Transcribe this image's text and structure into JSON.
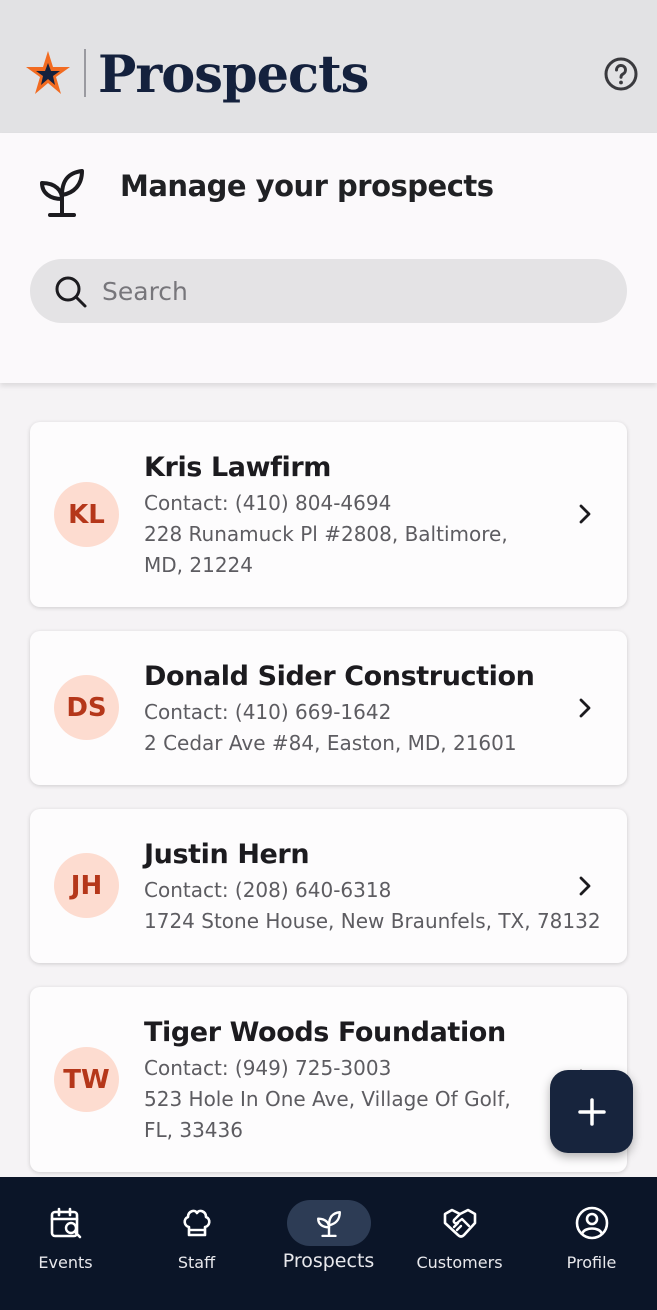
{
  "header": {
    "title": "Prospects",
    "help_icon": "help-circle-icon",
    "logo": "star-logo",
    "colors": {
      "background": "#e2e2e4",
      "title": "#14213d",
      "star_orange": "#f26b21",
      "star_navy": "#14213d"
    }
  },
  "panel": {
    "icon": "sprout-icon",
    "title": "Manage your prospects",
    "search_placeholder": "Search",
    "search_value": ""
  },
  "prospects": [
    {
      "initials": "KL",
      "name": "Kris Lawfirm",
      "contact": "Contact: (410) 804-4694",
      "address": "228 Runamuck Pl #2808, Baltimore, MD, 21224"
    },
    {
      "initials": "DS",
      "name": "Donald Sider Construction",
      "contact": "Contact: (410) 669-1642",
      "address": "2 Cedar Ave #84, Easton, MD, 21601"
    },
    {
      "initials": "JH",
      "name": "Justin Hern",
      "contact": "Contact: (208) 640-6318",
      "address": "1724 Stone House, New Braunfels, TX, 78132"
    },
    {
      "initials": "TW",
      "name": "Tiger Woods Foundation",
      "contact": "Contact: (949) 725-3003",
      "address": "523 Hole In One Ave, Village Of Golf, FL, 33436"
    }
  ],
  "fab": {
    "icon": "plus-icon"
  },
  "nav": {
    "items": [
      {
        "label": "Events",
        "icon": "calendar-search-icon"
      },
      {
        "label": "Staff",
        "icon": "chef-hat-icon"
      },
      {
        "label": "Prospects",
        "icon": "sprout-icon",
        "active": true
      },
      {
        "label": "Customers",
        "icon": "handshake-icon"
      },
      {
        "label": "Profile",
        "icon": "user-circle-icon"
      }
    ],
    "colors": {
      "background": "#0b1528",
      "active_pill": "#2d3c55"
    }
  },
  "colors": {
    "avatar_bg": "#fddcd0",
    "avatar_text": "#b5371a",
    "fab": "#17243d"
  }
}
